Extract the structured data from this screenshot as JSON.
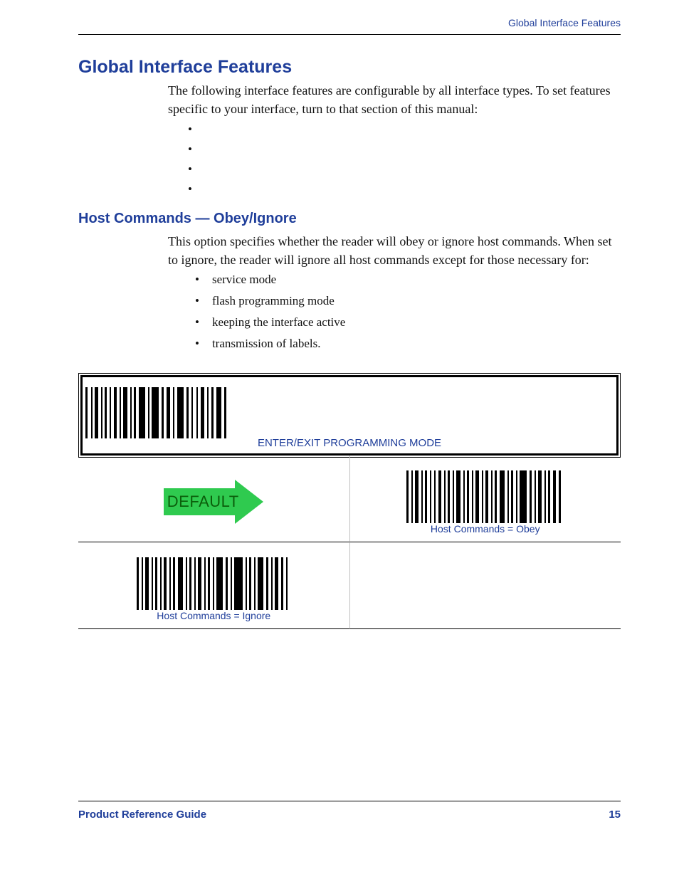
{
  "header": {
    "running_title": "Global Interface Features"
  },
  "h1": "Global Interface Features",
  "intro": "The following interface features are configurable by all interface types. To set features specific to your interface, turn to that section of this manual:",
  "h2": "Host Commands — Obey/Ignore",
  "p2": "This option specifies whether the reader will obey or ignore host commands. When set to ignore, the reader will ignore all host commands except for those necessary for:",
  "list2": [
    "service mode",
    "flash programming mode",
    "keeping the interface active",
    "transmission of labels."
  ],
  "programming_box": {
    "label": "ENTER/EXIT PROGRAMMING MODE"
  },
  "grid": {
    "default_label": "DEFAULT",
    "obey_label": "Host Commands = Obey",
    "ignore_label": "Host Commands = Ignore"
  },
  "footer": {
    "guide": "Product Reference Guide",
    "page": "15"
  }
}
